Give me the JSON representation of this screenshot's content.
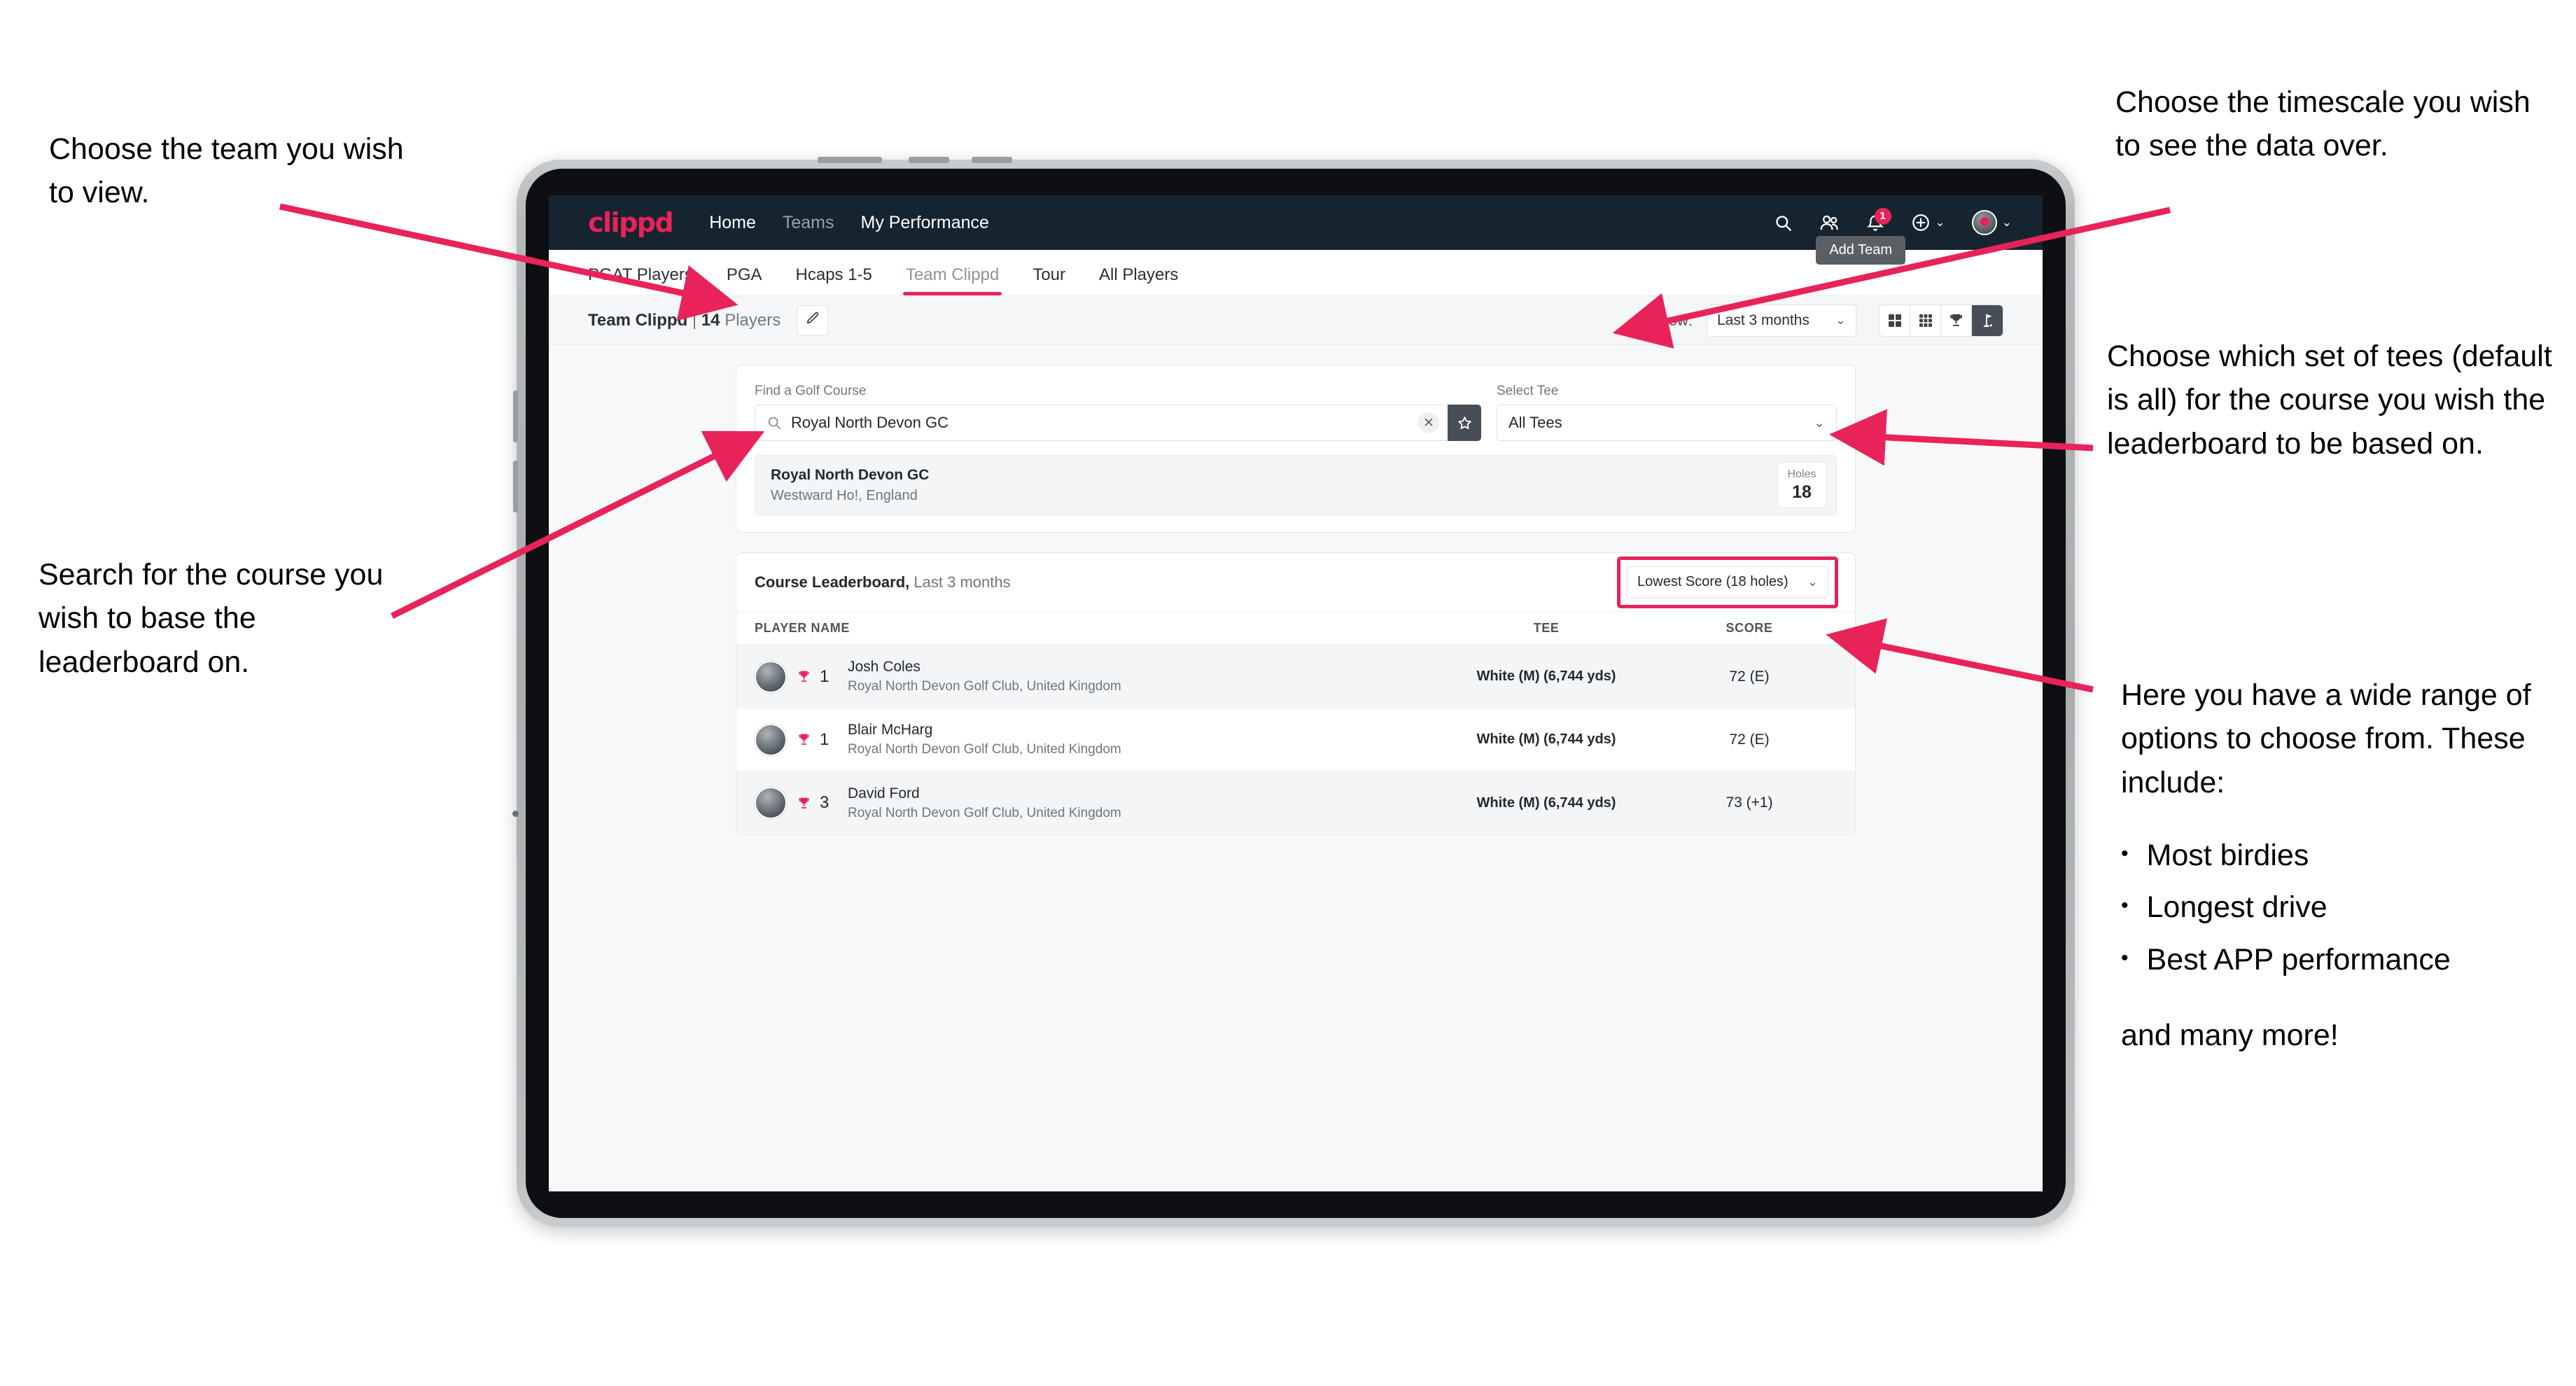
{
  "annotations": {
    "left_top": "Choose the team you wish to view.",
    "left_bottom": "Search for the course you wish to base the leaderboard on.",
    "right_top": "Choose the timescale you wish to see the data over.",
    "right_mid": "Choose which set of tees (default is all) for the course you wish the leaderboard to be based on.",
    "right_bottom_intro": "Here you have a wide range of options to choose from. These include:",
    "right_bottom_list": [
      "Most birdies",
      "Longest drive",
      "Best APP performance"
    ],
    "right_bottom_tail": "and many more!"
  },
  "navbar": {
    "logo": "clippd",
    "links": [
      {
        "label": "Home",
        "active": true
      },
      {
        "label": "Teams",
        "active": false
      },
      {
        "label": "My Performance",
        "active": true
      }
    ],
    "icons": [
      "search-icon",
      "people-icon",
      "bell-icon",
      "plus-circle-icon",
      "avatar-icon"
    ],
    "notification_count": "1"
  },
  "tooltip": {
    "text": "Add Team"
  },
  "subnav": {
    "tabs": [
      {
        "label": "PGAT Players",
        "active": false,
        "muted": false
      },
      {
        "label": "PGA",
        "active": false,
        "muted": false
      },
      {
        "label": "Hcaps 1-5",
        "active": false,
        "muted": false
      },
      {
        "label": "Team Clippd",
        "active": true,
        "muted": true
      },
      {
        "label": "Tour",
        "active": false,
        "muted": false
      },
      {
        "label": "All Players",
        "active": false,
        "muted": false
      }
    ]
  },
  "toolbar": {
    "team_name": "Team Clippd",
    "separator": "|",
    "player_count": "14",
    "players_word": "Players",
    "edit_icon": "pencil-icon",
    "show_label": "Show:",
    "show_value": "Last 3 months",
    "view_toggles": [
      {
        "name": "grid-4-icon",
        "active": false
      },
      {
        "name": "grid-9-icon",
        "active": false
      },
      {
        "name": "trophy-icon",
        "active": false
      },
      {
        "name": "golf-flag-icon",
        "active": true
      }
    ]
  },
  "search": {
    "course_label": "Find a Golf Course",
    "course_value": "Royal North Devon GC",
    "course_placeholder": "Find a Golf Course",
    "clear_icon": "close-icon",
    "star_icon": "star-icon",
    "tee_label": "Select Tee",
    "tee_value": "All Tees"
  },
  "course_result": {
    "name": "Royal North Devon GC",
    "location": "Westward Ho!, England",
    "holes_label": "Holes",
    "holes_value": "18"
  },
  "leaderboard": {
    "title": "Course Leaderboard,",
    "subtitle": "Last 3 months",
    "metric_value": "Lowest Score (18 holes)",
    "columns": {
      "player": "PLAYER NAME",
      "tee": "TEE",
      "score": "SCORE"
    },
    "rows": [
      {
        "rank": "1",
        "name": "Josh Coles",
        "club": "Royal North Devon Golf Club, United Kingdom",
        "tee": "White (M) (6,744 yds)",
        "score": "72 (E)"
      },
      {
        "rank": "1",
        "name": "Blair McHarg",
        "club": "Royal North Devon Golf Club, United Kingdom",
        "tee": "White (M) (6,744 yds)",
        "score": "72 (E)"
      },
      {
        "rank": "3",
        "name": "David Ford",
        "club": "Royal North Devon Golf Club, United Kingdom",
        "tee": "White (M) (6,744 yds)",
        "score": "73 (+1)"
      }
    ]
  },
  "colors": {
    "brand_pink": "#e8235a",
    "navbar_dark": "#16242f",
    "toggle_active": "#474e55"
  }
}
